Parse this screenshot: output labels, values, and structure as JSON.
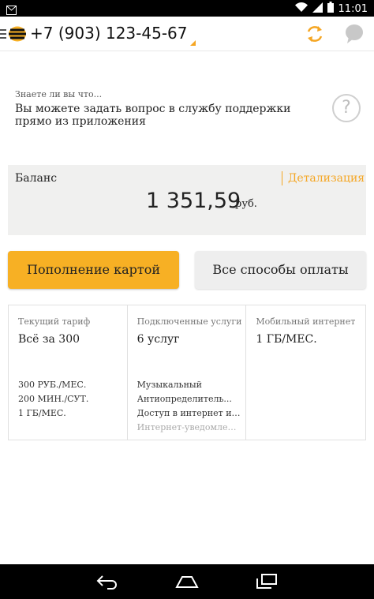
{
  "status_bar": {
    "time": "11:01",
    "icons": [
      "notification-icon",
      "wifi-icon",
      "signal-icon",
      "battery-icon"
    ]
  },
  "app_bar": {
    "phone_number": "+7 (903) 123-45-67",
    "icons": [
      "menu-icon",
      "beeline-logo-icon",
      "refresh-icon",
      "chat-icon"
    ],
    "accent_color": "#f5a623"
  },
  "tip": {
    "title": "Знаете ли вы что...",
    "text": "Вы можете задать вопрос в службу поддержки прямо из приложения",
    "icon": "question-icon"
  },
  "balance": {
    "label": "Баланс",
    "detail_link": "Детализация",
    "amount": "1 351,59",
    "currency": "руб."
  },
  "buttons": {
    "top_up_card": "Пополнение картой",
    "all_payment_methods": "Все способы оплаты",
    "primary_color": "#f7b024"
  },
  "cards": [
    {
      "label": "Текущий тариф",
      "value": "Всё за 300",
      "items": [
        "300 РУБ./МЕС.",
        "200 МИН./СУТ.",
        "1 ГБ/МЕС."
      ]
    },
    {
      "label": "Подключенные услуги",
      "value": "6 услуг",
      "items": [
        "Музыкальный",
        "Антиопределитель...",
        "Доступ в интернет и ...",
        "Интернет-уведомлен..."
      ]
    },
    {
      "label": "Мобильный интернет",
      "value": "1 ГБ/МЕС.",
      "items": []
    }
  ],
  "nav_bar": {
    "icons": [
      "back-icon",
      "home-icon",
      "recents-icon"
    ]
  }
}
